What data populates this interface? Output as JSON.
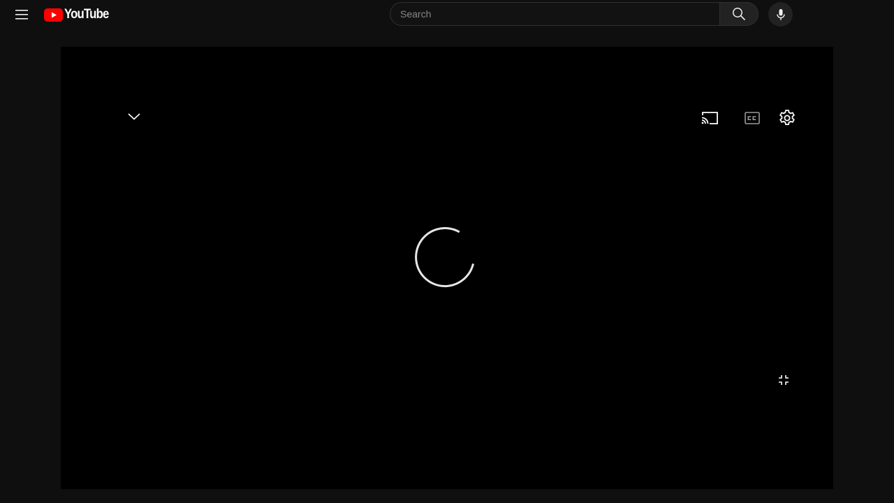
{
  "app": {
    "logo_text": "YouTube",
    "brand_color": "#ff0000"
  },
  "masthead": {
    "menu_icon": "hamburger-menu-icon",
    "search": {
      "placeholder": "Search",
      "value": ""
    },
    "search_icon": "search-icon",
    "voice_search_icon": "microphone-icon"
  },
  "player": {
    "state": "loading",
    "controls": {
      "collapse_icon": "chevron-down-icon",
      "cast_icon": "cast-icon",
      "captions_icon": "closed-captions-icon",
      "settings_icon": "gear-icon",
      "exit_fullscreen_icon": "exit-fullscreen-icon"
    },
    "colors": {
      "background": "#000000",
      "spinner": "#e6e6e6"
    }
  }
}
